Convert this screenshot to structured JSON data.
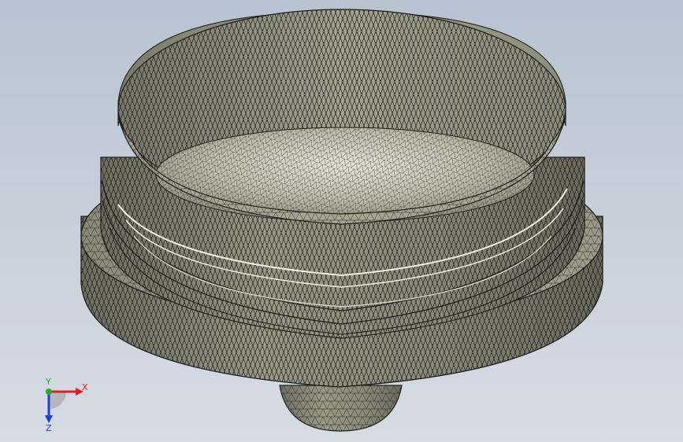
{
  "viewport": {
    "background_top": "#b8c3d1",
    "background_bottom": "#d6dce4"
  },
  "model": {
    "shading_color": "#8c8c7a",
    "edge_color": "#1e1e1e"
  },
  "triad": {
    "x_label": "X",
    "y_label": "Y",
    "z_label": "Z",
    "x_color": "#e01e1e",
    "y_color": "#1eb41e",
    "z_color": "#1e3cdc"
  }
}
